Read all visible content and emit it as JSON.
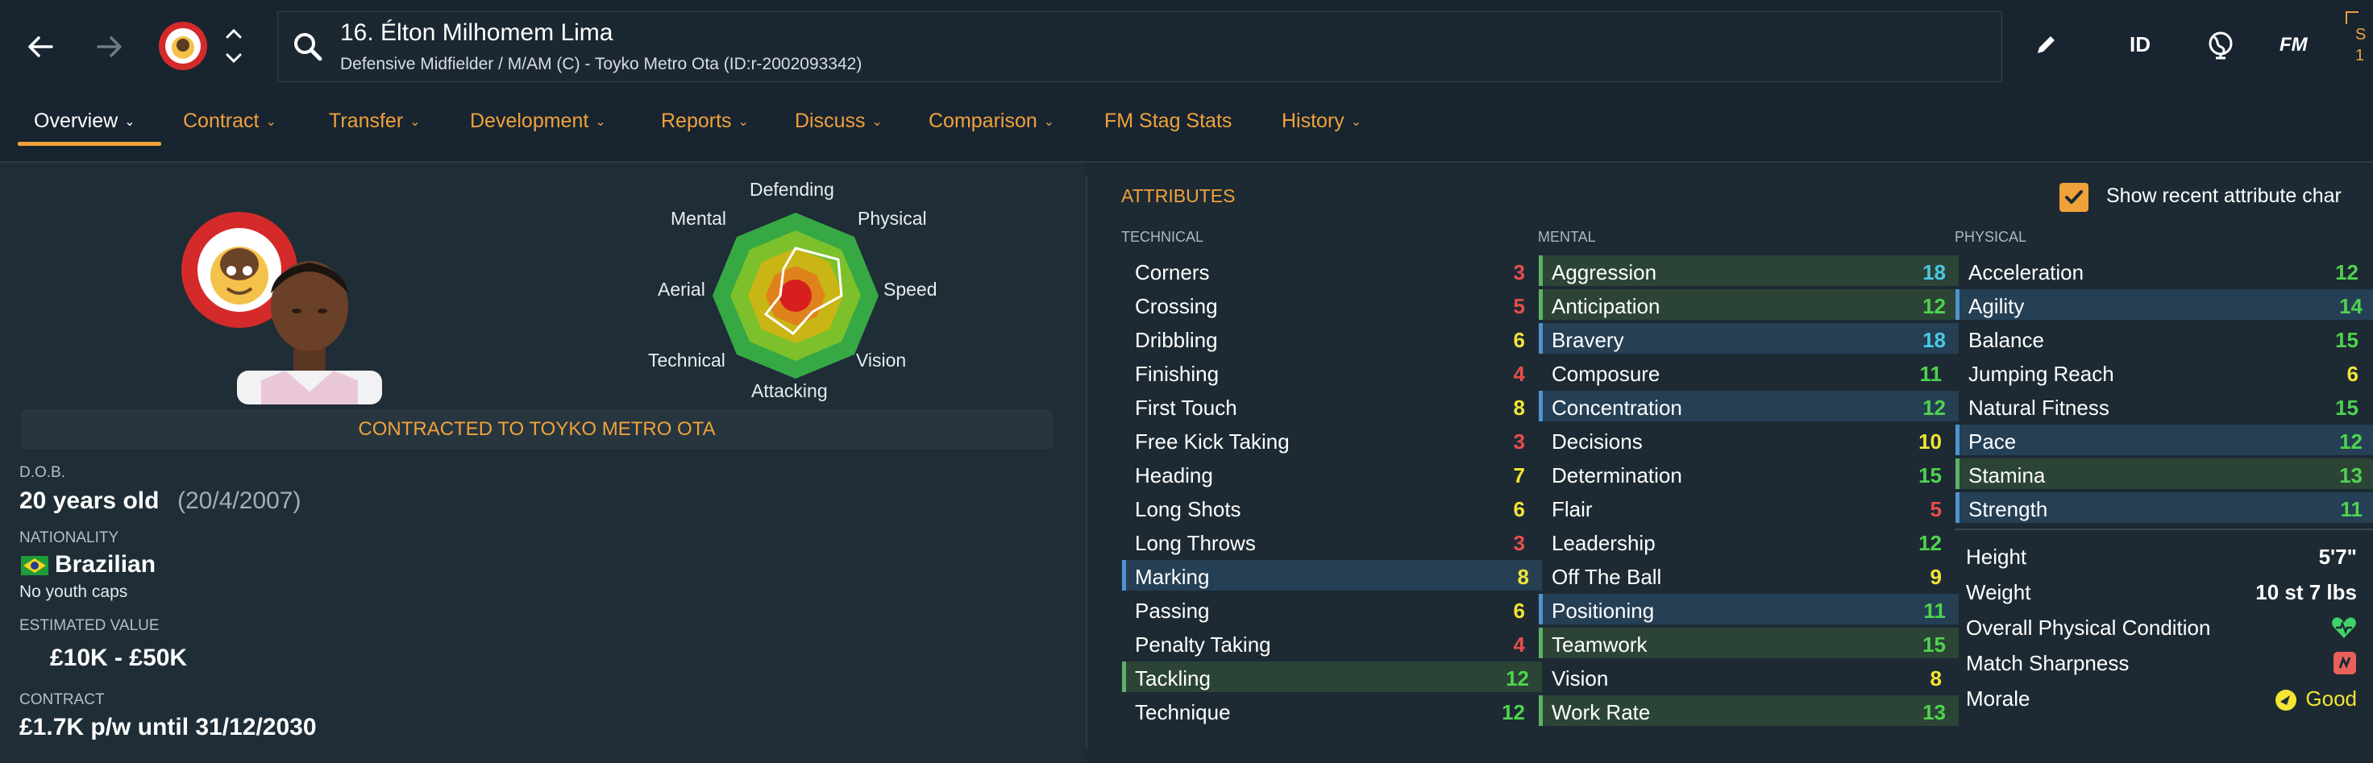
{
  "header": {
    "player_name": "16. Élton Milhomem Lima",
    "player_sub": "Defensive Midfielder / M/AM (C) - Toyko Metro Ota (ID:r-2002093342)",
    "id_label": "ID",
    "fm_label": "FM",
    "edge_top": "S",
    "edge_bottom": "1"
  },
  "tabs": [
    {
      "label": "Overview"
    },
    {
      "label": "Contract"
    },
    {
      "label": "Transfer"
    },
    {
      "label": "Development"
    },
    {
      "label": "Reports"
    },
    {
      "label": "Discuss"
    },
    {
      "label": "Comparison"
    },
    {
      "label": "FM Stag Stats"
    },
    {
      "label": "History"
    }
  ],
  "radar": {
    "labels": {
      "defending": "Defending",
      "physical": "Physical",
      "speed": "Speed",
      "vision": "Vision",
      "attacking": "Attacking",
      "technical": "Technical",
      "aerial": "Aerial",
      "mental": "Mental"
    }
  },
  "profile": {
    "contracted_banner": "CONTRACTED TO TOYKO METRO OTA",
    "dob_label": "D.O.B.",
    "age": "20 years old",
    "dob": "(20/4/2007)",
    "nationality_label": "NATIONALITY",
    "nationality": "Brazilian",
    "youth_caps": "No youth caps",
    "value_label": "ESTIMATED VALUE",
    "value": "£10K - £50K",
    "contract_label": "CONTRACT",
    "contract": "£1.7K p/w until 31/12/2030"
  },
  "attributes": {
    "title": "ATTRIBUTES",
    "recent_changes_label": "Show recent attribute char",
    "recent_changes_checked": true,
    "technical_label": "TECHNICAL",
    "mental_label": "MENTAL",
    "physical_label": "PHYSICAL",
    "technical": [
      {
        "name": "Corners",
        "value": "3"
      },
      {
        "name": "Crossing",
        "value": "5"
      },
      {
        "name": "Dribbling",
        "value": "6"
      },
      {
        "name": "Finishing",
        "value": "4"
      },
      {
        "name": "First Touch",
        "value": "8"
      },
      {
        "name": "Free Kick Taking",
        "value": "3"
      },
      {
        "name": "Heading",
        "value": "7"
      },
      {
        "name": "Long Shots",
        "value": "6"
      },
      {
        "name": "Long Throws",
        "value": "3"
      },
      {
        "name": "Marking",
        "value": "8",
        "hl": "blue"
      },
      {
        "name": "Passing",
        "value": "6"
      },
      {
        "name": "Penalty Taking",
        "value": "4"
      },
      {
        "name": "Tackling",
        "value": "12",
        "hl": "green"
      },
      {
        "name": "Technique",
        "value": "12"
      }
    ],
    "mental": [
      {
        "name": "Aggression",
        "value": "18",
        "hl": "green"
      },
      {
        "name": "Anticipation",
        "value": "12",
        "hl": "green"
      },
      {
        "name": "Bravery",
        "value": "18",
        "hl": "blue"
      },
      {
        "name": "Composure",
        "value": "11"
      },
      {
        "name": "Concentration",
        "value": "12",
        "hl": "blue"
      },
      {
        "name": "Decisions",
        "value": "10"
      },
      {
        "name": "Determination",
        "value": "15"
      },
      {
        "name": "Flair",
        "value": "5"
      },
      {
        "name": "Leadership",
        "value": "12"
      },
      {
        "name": "Off The Ball",
        "value": "9"
      },
      {
        "name": "Positioning",
        "value": "11",
        "hl": "blue"
      },
      {
        "name": "Teamwork",
        "value": "15",
        "hl": "green"
      },
      {
        "name": "Vision",
        "value": "8"
      },
      {
        "name": "Work Rate",
        "value": "13",
        "hl": "green"
      }
    ],
    "physical": [
      {
        "name": "Acceleration",
        "value": "12"
      },
      {
        "name": "Agility",
        "value": "14",
        "hl": "blue"
      },
      {
        "name": "Balance",
        "value": "15"
      },
      {
        "name": "Jumping Reach",
        "value": "6"
      },
      {
        "name": "Natural Fitness",
        "value": "15"
      },
      {
        "name": "Pace",
        "value": "12",
        "hl": "blue"
      },
      {
        "name": "Stamina",
        "value": "13",
        "hl": "green"
      },
      {
        "name": "Strength",
        "value": "11",
        "hl": "blue"
      }
    ],
    "physical_info": [
      {
        "name": "Height",
        "value": "5'7\""
      },
      {
        "name": "Weight",
        "value": "10 st 7 lbs"
      },
      {
        "name": "Overall Physical Condition",
        "icon": "heart-icon"
      },
      {
        "name": "Match Sharpness",
        "icon": "sharpness-icon"
      },
      {
        "name": "Morale",
        "value": "Good",
        "icon": "morale-icon"
      }
    ]
  },
  "colors": {
    "accent": "#f0a23a",
    "red": "#e84d4d",
    "yellow": "#f2e534",
    "green": "#4fd34f",
    "cyan": "#4ac8e4"
  }
}
